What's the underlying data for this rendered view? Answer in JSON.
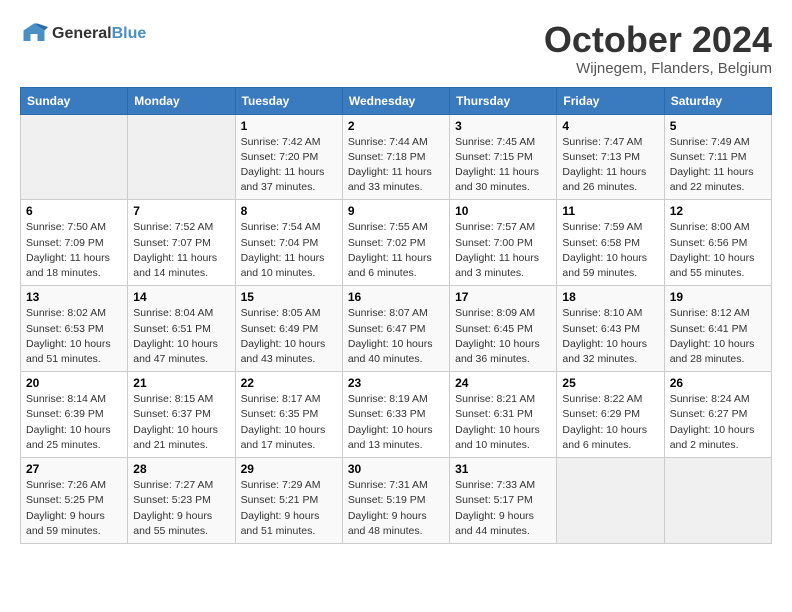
{
  "header": {
    "logo_line1": "General",
    "logo_line2": "Blue",
    "month": "October 2024",
    "location": "Wijnegem, Flanders, Belgium"
  },
  "days_of_week": [
    "Sunday",
    "Monday",
    "Tuesday",
    "Wednesday",
    "Thursday",
    "Friday",
    "Saturday"
  ],
  "weeks": [
    [
      {
        "day": "",
        "content": ""
      },
      {
        "day": "",
        "content": ""
      },
      {
        "day": "1",
        "content": "Sunrise: 7:42 AM\nSunset: 7:20 PM\nDaylight: 11 hours and 37 minutes."
      },
      {
        "day": "2",
        "content": "Sunrise: 7:44 AM\nSunset: 7:18 PM\nDaylight: 11 hours and 33 minutes."
      },
      {
        "day": "3",
        "content": "Sunrise: 7:45 AM\nSunset: 7:15 PM\nDaylight: 11 hours and 30 minutes."
      },
      {
        "day": "4",
        "content": "Sunrise: 7:47 AM\nSunset: 7:13 PM\nDaylight: 11 hours and 26 minutes."
      },
      {
        "day": "5",
        "content": "Sunrise: 7:49 AM\nSunset: 7:11 PM\nDaylight: 11 hours and 22 minutes."
      }
    ],
    [
      {
        "day": "6",
        "content": "Sunrise: 7:50 AM\nSunset: 7:09 PM\nDaylight: 11 hours and 18 minutes."
      },
      {
        "day": "7",
        "content": "Sunrise: 7:52 AM\nSunset: 7:07 PM\nDaylight: 11 hours and 14 minutes."
      },
      {
        "day": "8",
        "content": "Sunrise: 7:54 AM\nSunset: 7:04 PM\nDaylight: 11 hours and 10 minutes."
      },
      {
        "day": "9",
        "content": "Sunrise: 7:55 AM\nSunset: 7:02 PM\nDaylight: 11 hours and 6 minutes."
      },
      {
        "day": "10",
        "content": "Sunrise: 7:57 AM\nSunset: 7:00 PM\nDaylight: 11 hours and 3 minutes."
      },
      {
        "day": "11",
        "content": "Sunrise: 7:59 AM\nSunset: 6:58 PM\nDaylight: 10 hours and 59 minutes."
      },
      {
        "day": "12",
        "content": "Sunrise: 8:00 AM\nSunset: 6:56 PM\nDaylight: 10 hours and 55 minutes."
      }
    ],
    [
      {
        "day": "13",
        "content": "Sunrise: 8:02 AM\nSunset: 6:53 PM\nDaylight: 10 hours and 51 minutes."
      },
      {
        "day": "14",
        "content": "Sunrise: 8:04 AM\nSunset: 6:51 PM\nDaylight: 10 hours and 47 minutes."
      },
      {
        "day": "15",
        "content": "Sunrise: 8:05 AM\nSunset: 6:49 PM\nDaylight: 10 hours and 43 minutes."
      },
      {
        "day": "16",
        "content": "Sunrise: 8:07 AM\nSunset: 6:47 PM\nDaylight: 10 hours and 40 minutes."
      },
      {
        "day": "17",
        "content": "Sunrise: 8:09 AM\nSunset: 6:45 PM\nDaylight: 10 hours and 36 minutes."
      },
      {
        "day": "18",
        "content": "Sunrise: 8:10 AM\nSunset: 6:43 PM\nDaylight: 10 hours and 32 minutes."
      },
      {
        "day": "19",
        "content": "Sunrise: 8:12 AM\nSunset: 6:41 PM\nDaylight: 10 hours and 28 minutes."
      }
    ],
    [
      {
        "day": "20",
        "content": "Sunrise: 8:14 AM\nSunset: 6:39 PM\nDaylight: 10 hours and 25 minutes."
      },
      {
        "day": "21",
        "content": "Sunrise: 8:15 AM\nSunset: 6:37 PM\nDaylight: 10 hours and 21 minutes."
      },
      {
        "day": "22",
        "content": "Sunrise: 8:17 AM\nSunset: 6:35 PM\nDaylight: 10 hours and 17 minutes."
      },
      {
        "day": "23",
        "content": "Sunrise: 8:19 AM\nSunset: 6:33 PM\nDaylight: 10 hours and 13 minutes."
      },
      {
        "day": "24",
        "content": "Sunrise: 8:21 AM\nSunset: 6:31 PM\nDaylight: 10 hours and 10 minutes."
      },
      {
        "day": "25",
        "content": "Sunrise: 8:22 AM\nSunset: 6:29 PM\nDaylight: 10 hours and 6 minutes."
      },
      {
        "day": "26",
        "content": "Sunrise: 8:24 AM\nSunset: 6:27 PM\nDaylight: 10 hours and 2 minutes."
      }
    ],
    [
      {
        "day": "27",
        "content": "Sunrise: 7:26 AM\nSunset: 5:25 PM\nDaylight: 9 hours and 59 minutes."
      },
      {
        "day": "28",
        "content": "Sunrise: 7:27 AM\nSunset: 5:23 PM\nDaylight: 9 hours and 55 minutes."
      },
      {
        "day": "29",
        "content": "Sunrise: 7:29 AM\nSunset: 5:21 PM\nDaylight: 9 hours and 51 minutes."
      },
      {
        "day": "30",
        "content": "Sunrise: 7:31 AM\nSunset: 5:19 PM\nDaylight: 9 hours and 48 minutes."
      },
      {
        "day": "31",
        "content": "Sunrise: 7:33 AM\nSunset: 5:17 PM\nDaylight: 9 hours and 44 minutes."
      },
      {
        "day": "",
        "content": ""
      },
      {
        "day": "",
        "content": ""
      }
    ]
  ]
}
